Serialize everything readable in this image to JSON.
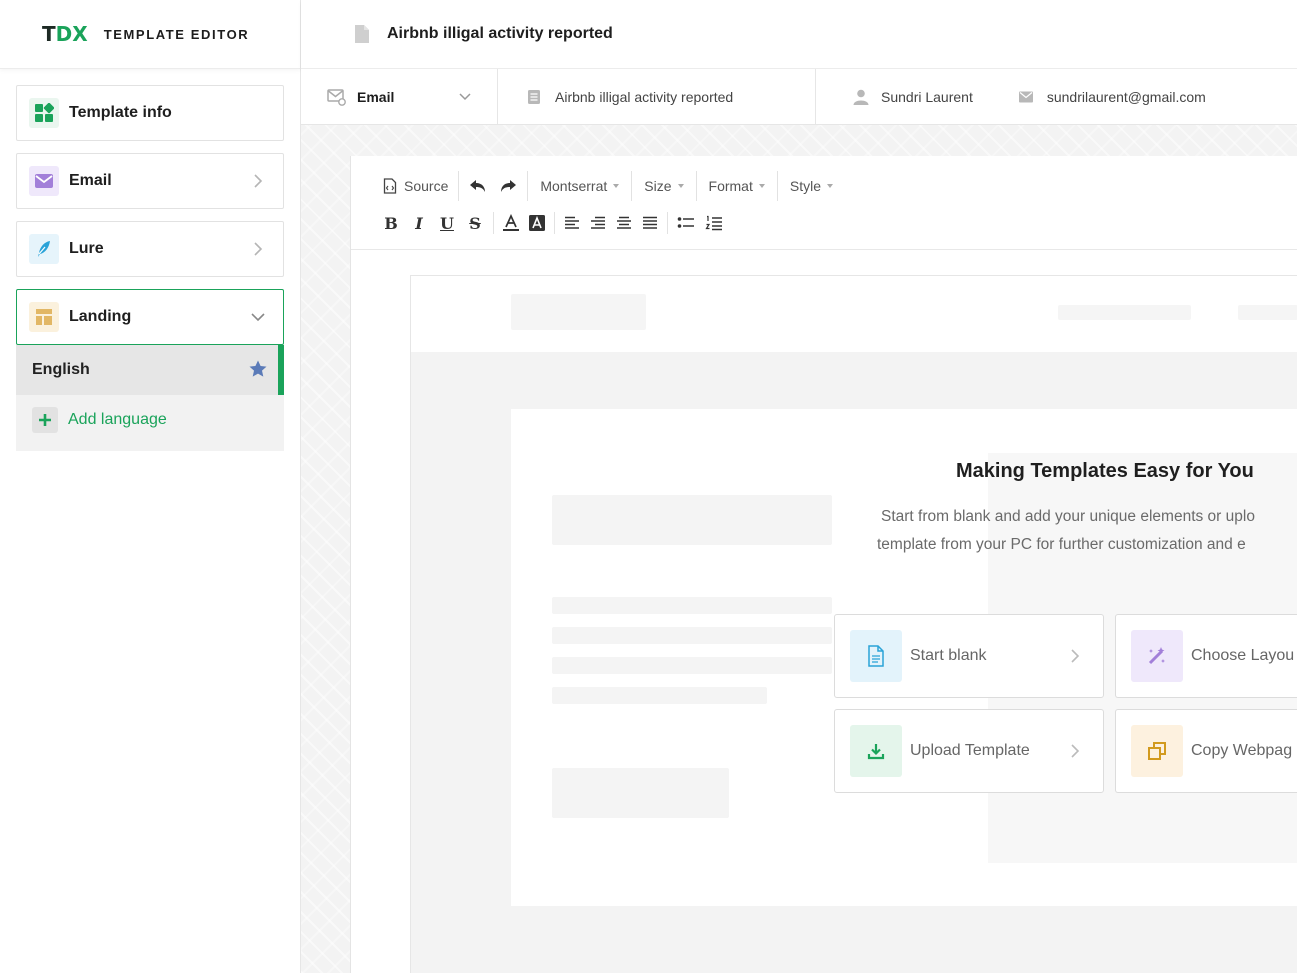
{
  "brand": {
    "logo_t": "T",
    "logo_dx": "DX",
    "title": "TEMPLATE EDITOR"
  },
  "sidebar": {
    "items": [
      {
        "label": "Template info",
        "icon": "grid-icon"
      },
      {
        "label": "Email",
        "icon": "envelope-icon"
      },
      {
        "label": "Lure",
        "icon": "feather-icon"
      },
      {
        "label": "Landing",
        "icon": "layout-icon"
      }
    ],
    "languages": [
      {
        "label": "English",
        "default": true
      }
    ],
    "add_language_label": "Add language"
  },
  "header": {
    "doc_title": "Airbnb illigal activity reported"
  },
  "infobar": {
    "channel": "Email",
    "subject": "Airbnb illigal activity reported",
    "sender_name": "Sundri Laurent",
    "sender_email": "sundrilaurent@gmail.com"
  },
  "toolbar": {
    "source_label": "Source",
    "font": "Montserrat",
    "size": "Size",
    "format": "Format",
    "style": "Style"
  },
  "content": {
    "title": "Making Templates Easy for You",
    "desc_line1": "Start from blank and add your unique elements or uplo",
    "desc_line2": "template from your PC for further customization and e",
    "options": [
      {
        "label": "Start blank",
        "icon": "document-icon"
      },
      {
        "label": "Choose Layou",
        "icon": "magic-wand-icon"
      },
      {
        "label": "Upload Template",
        "icon": "download-icon"
      },
      {
        "label": "Copy Webpag",
        "icon": "copy-icon"
      }
    ]
  },
  "colors": {
    "accent": "#1aa35a",
    "star": "#5b7bb8",
    "purple": "#a27fd9",
    "blue": "#2aa3d8",
    "gold": "#d29a1e"
  }
}
